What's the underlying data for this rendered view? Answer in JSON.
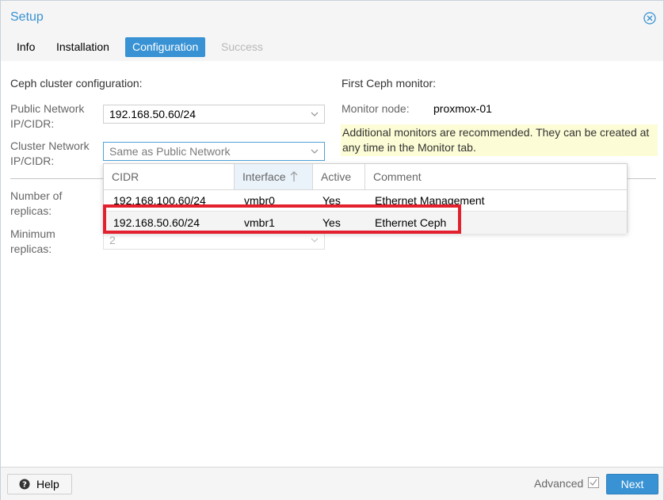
{
  "window": {
    "title": "Setup"
  },
  "tabs": [
    {
      "label": "Info"
    },
    {
      "label": "Installation"
    },
    {
      "label": "Configuration"
    },
    {
      "label": "Success"
    }
  ],
  "left": {
    "section_title": "Ceph cluster configuration:",
    "public_network_label": "Public Network IP/CIDR:",
    "public_network_line1": "Public Network",
    "public_network_line2": "IP/CIDR:",
    "public_network_value": "192.168.50.60/24",
    "cluster_network_line1": "Cluster Network",
    "cluster_network_line2": "IP/CIDR:",
    "cluster_network_value": "Same as Public Network",
    "replicas_line1": "Number of",
    "replicas_line2": "replicas:",
    "min_replicas_line1": "Minimum",
    "min_replicas_line2": "replicas:",
    "min_replicas_value": "2"
  },
  "right": {
    "section_title": "First Ceph monitor:",
    "monitor_node_label": "Monitor node:",
    "monitor_node_value": "proxmox-01",
    "notice_line1": "Additional monitors are recommended. They can be created at",
    "notice_line2": "any time in the Monitor tab."
  },
  "dropdown": {
    "columns": [
      {
        "label": "CIDR"
      },
      {
        "label": "Interface"
      },
      {
        "label": "Active"
      },
      {
        "label": "Comment"
      }
    ],
    "rows": [
      {
        "cidr": "192.168.100.60/24",
        "iface": "vmbr0",
        "active": "Yes",
        "comment": "Ethernet Management"
      },
      {
        "cidr": "192.168.50.60/24",
        "iface": "vmbr1",
        "active": "Yes",
        "comment": "Ethernet Ceph"
      }
    ]
  },
  "footer": {
    "help_label": "Help",
    "advanced_label": "Advanced",
    "next_label": "Next"
  },
  "colors": {
    "accent": "#3892d4",
    "highlight": "#e3202d",
    "notice_bg": "#fcfcd6"
  }
}
